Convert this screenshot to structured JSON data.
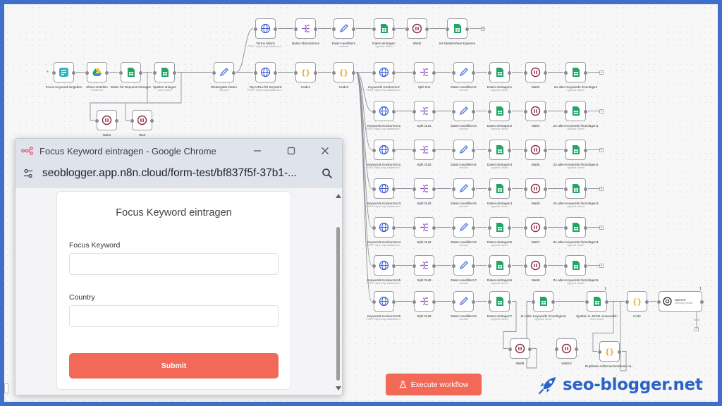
{
  "popup": {
    "window_title": "Focus Keyword eintragen - Google Chrome",
    "url": "seoblogger.app.n8n.cloud/form-test/bf837f5f-37b1-...",
    "form_title": "Focus Keyword eintragen",
    "fields": [
      {
        "label": "Focus Keyword",
        "value": ""
      },
      {
        "label": "Country",
        "value": ""
      }
    ],
    "submit_label": "Submit"
  },
  "execute_label": "Execute workflow",
  "brand": "seo-blogger.net",
  "colors": {
    "accent": "#f36957",
    "brand_blue": "#2a64c6",
    "frame": "#3f6fc9"
  },
  "nodes": [
    {
      "label": "Focus Keyword eingeben",
      "sub": "",
      "icon": "form"
    },
    {
      "label": "Sheet erstellen",
      "sub": "Create file",
      "icon": "drive"
    },
    {
      "label": "Daten für Request eintragen",
      "sub": "",
      "icon": "sheet"
    },
    {
      "label": "Spalten anlegen",
      "sub": "Insert sheet",
      "icon": "sheet"
    },
    {
      "label": "Wait1",
      "sub": "",
      "icon": "wait"
    },
    {
      "label": "Wait",
      "sub": "",
      "icon": "wait"
    },
    {
      "label": "Weitergabe Daten",
      "sub": "manual",
      "icon": "edit"
    },
    {
      "label": "Terms Match",
      "sub": "POST: https://api.dataforseo...",
      "icon": "http"
    },
    {
      "label": "Daten übernehmen",
      "sub": "",
      "icon": "split"
    },
    {
      "label": "Daten rausfiltern",
      "sub": "manual",
      "icon": "edit"
    },
    {
      "label": "Daten eintragen",
      "sub": "append: sheet",
      "icon": "sheet"
    },
    {
      "label": "Wait2",
      "sub": "",
      "icon": "wait"
    },
    {
      "label": "Ins Mastersheet kopieren",
      "sub": "",
      "icon": "sheet"
    },
    {
      "label": "Top URLs für Keyword",
      "sub": "POST: https://api.dataforseo...",
      "icon": "http"
    },
    {
      "label": "Code1",
      "sub": "",
      "icon": "code"
    },
    {
      "label": "Code2",
      "sub": "",
      "icon": "code"
    },
    {
      "label": "Keywords Konkurrenz",
      "sub": "POST: https://api.dataforseo...",
      "icon": "http"
    },
    {
      "label": "Split Out",
      "sub": "",
      "icon": "split"
    },
    {
      "label": "Daten rausfiltern2",
      "sub": "manual",
      "icon": "edit"
    },
    {
      "label": "Daten eintragen1",
      "sub": "append: sheet",
      "icon": "sheet"
    },
    {
      "label": "Wait3",
      "sub": "",
      "icon": "wait"
    },
    {
      "label": "Zu allen Keywords hinzufügen",
      "sub": "append: sheet",
      "icon": "sheet"
    },
    {
      "label": "Keywords Konkurrenz1",
      "sub": "POST: https://api.dataforseo...",
      "icon": "http"
    },
    {
      "label": "Split Out1",
      "sub": "",
      "icon": "split"
    },
    {
      "label": "Daten rausfiltern3",
      "sub": "manual",
      "icon": "edit"
    },
    {
      "label": "Daten eintragen2",
      "sub": "append: sheet",
      "icon": "sheet"
    },
    {
      "label": "Wait4",
      "sub": "",
      "icon": "wait"
    },
    {
      "label": "Zu allen Keywords hinzufügen1",
      "sub": "append: sheet",
      "icon": "sheet"
    },
    {
      "label": "Keywords Konkurrenz2",
      "sub": "POST: https://api.dataforseo...",
      "icon": "http"
    },
    {
      "label": "Split Out2",
      "sub": "",
      "icon": "split"
    },
    {
      "label": "Daten rausfiltern4",
      "sub": "manual",
      "icon": "edit"
    },
    {
      "label": "Daten eintragen3",
      "sub": "append: sheet",
      "icon": "sheet"
    },
    {
      "label": "Wait5",
      "sub": "",
      "icon": "wait"
    },
    {
      "label": "Zu allen Keywords hinzufügen2",
      "sub": "append: sheet",
      "icon": "sheet"
    },
    {
      "label": "Keywords Konkurrenz3",
      "sub": "POST: https://api.dataforseo...",
      "icon": "http"
    },
    {
      "label": "Split Out3",
      "sub": "",
      "icon": "split"
    },
    {
      "label": "Daten rausfiltern5",
      "sub": "manual",
      "icon": "edit"
    },
    {
      "label": "Daten eintragen4",
      "sub": "append: sheet",
      "icon": "sheet"
    },
    {
      "label": "Wait6",
      "sub": "",
      "icon": "wait"
    },
    {
      "label": "Zu allen Keywords hinzufügen3",
      "sub": "append: sheet",
      "icon": "sheet"
    },
    {
      "label": "Keywords Konkurrenz4",
      "sub": "POST: https://api.dataforseo...",
      "icon": "http"
    },
    {
      "label": "Split Out4",
      "sub": "",
      "icon": "split"
    },
    {
      "label": "Daten rausfiltern6",
      "sub": "manual",
      "icon": "edit"
    },
    {
      "label": "Daten eintragen5",
      "sub": "append: sheet",
      "icon": "sheet"
    },
    {
      "label": "Wait7",
      "sub": "",
      "icon": "wait"
    },
    {
      "label": "Zu allen Keywords hinzufügen4",
      "sub": "append: sheet",
      "icon": "sheet"
    },
    {
      "label": "Keywords Konkurrenz5",
      "sub": "POST: https://api.dataforseo...",
      "icon": "http"
    },
    {
      "label": "Split Out5",
      "sub": "",
      "icon": "split"
    },
    {
      "label": "Daten rausfiltern7",
      "sub": "manual",
      "icon": "edit"
    },
    {
      "label": "Daten eintragen6",
      "sub": "append: sheet",
      "icon": "sheet"
    },
    {
      "label": "Wait8",
      "sub": "",
      "icon": "wait"
    },
    {
      "label": "Zu allen Keywords hinzufügen5",
      "sub": "append: sheet",
      "icon": "sheet"
    },
    {
      "label": "Keywords Konkurrenz6",
      "sub": "POST: https://api.dataforseo...",
      "icon": "http"
    },
    {
      "label": "Split Out6",
      "sub": "",
      "icon": "split"
    },
    {
      "label": "Daten rausfiltern8",
      "sub": "manual",
      "icon": "edit"
    },
    {
      "label": "Daten eintragen7",
      "sub": "append: sheet",
      "icon": "sheet"
    },
    {
      "label": "Zu allen Keywords hinzufügen6",
      "sub": "append: sheet",
      "icon": "sheet"
    },
    {
      "label": "Spalten in JSON umwandeln",
      "sub": "read: sheet",
      "icon": "sheet",
      "count": "1"
    },
    {
      "label": "Code",
      "sub": "",
      "icon": "code"
    },
    {
      "label": "Wait9",
      "sub": "",
      "icon": "wait"
    },
    {
      "label": "Wait10",
      "sub": "",
      "icon": "wait"
    },
    {
      "label": "Duplikate entfernen/sortieren na...",
      "sub": "",
      "icon": "code"
    },
    {
      "label": "OpenAI",
      "sub": "Message Model",
      "icon": "openai",
      "count": "1"
    }
  ],
  "openai_tools_label": "Tools"
}
